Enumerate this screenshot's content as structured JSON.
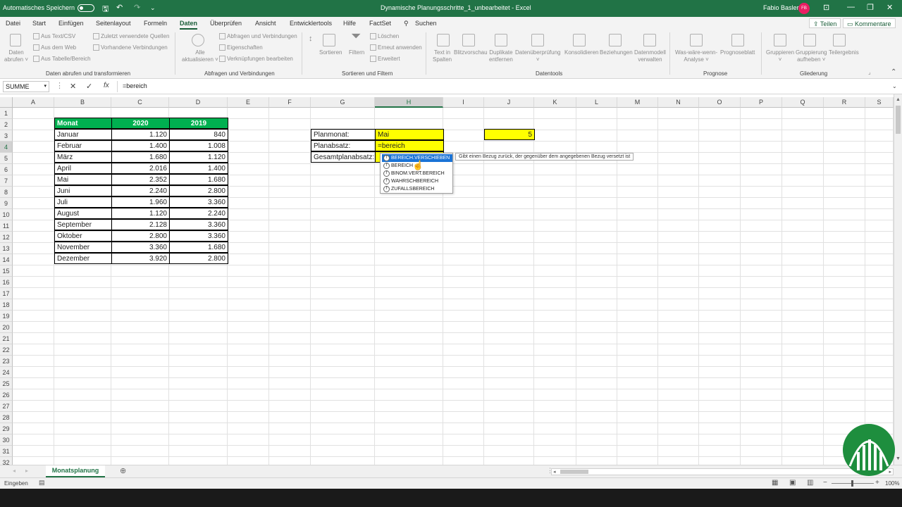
{
  "titlebar": {
    "autosave_label": "Automatisches Speichern",
    "doc_title": "Dynamische Planungsschritte_1_unbearbeitet  -  Excel",
    "user_name": "Fabio Basler",
    "user_initials": "FB"
  },
  "menu": {
    "items": [
      "Datei",
      "Start",
      "Einfügen",
      "Seitenlayout",
      "Formeln",
      "Daten",
      "Überprüfen",
      "Ansicht",
      "Entwicklertools",
      "Hilfe",
      "FactSet"
    ],
    "search_label": "Suchen",
    "share_label": "Teilen",
    "comments_label": "Kommentare"
  },
  "ribbon": {
    "daten_abrufen": "Daten\nabrufen ˅",
    "aus_text_csv": "Aus Text/CSV",
    "aus_dem_web": "Aus dem Web",
    "aus_tabelle": "Aus Tabelle/Bereich",
    "zuletzt": "Zuletzt verwendete Quellen",
    "vorhandene": "Vorhandene Verbindungen",
    "alle_aktualisieren": "Alle\naktualisieren ˅",
    "abfragen": "Abfragen und Verbindungen",
    "eigenschaften": "Eigenschaften",
    "verknuepfungen": "Verknüpfungen bearbeiten",
    "sortieren": "Sortieren",
    "filtern": "Filtern",
    "loeschen": "Löschen",
    "erneut": "Erneut anwenden",
    "erweitert": "Erweitert",
    "text_in_spalten": "Text in\nSpalten",
    "blitzvorschau": "Blitzvorschau",
    "duplikate": "Duplikate\nentfernen",
    "datenueberpruefung": "Datenüberprüfung\n˅",
    "konsolidieren": "Konsolidieren",
    "beziehungen": "Beziehungen",
    "datenmodell": "Datenmodell\nverwalten",
    "was_waere": "Was-wäre-wenn-\nAnalyse ˅",
    "prognoseblatt": "Prognoseblatt",
    "gruppieren": "Gruppieren\n˅",
    "gruppierung_aufheben": "Gruppierung\naufheben ˅",
    "teilergebnis": "Teilergebnis",
    "groups": {
      "daten_abrufen": "Daten abrufen und transformieren",
      "abfragen": "Abfragen und Verbindungen",
      "sortieren": "Sortieren und Filtern",
      "datentools": "Datentools",
      "prognose": "Prognose",
      "gliederung": "Gliederung"
    }
  },
  "formula_bar": {
    "name_box": "SUMME",
    "formula": "=bereich"
  },
  "columns": [
    "A",
    "B",
    "C",
    "D",
    "E",
    "F",
    "G",
    "H",
    "I",
    "J",
    "K",
    "L",
    "M",
    "N",
    "O",
    "P",
    "Q",
    "R",
    "S"
  ],
  "rows": [
    "1",
    "2",
    "3",
    "4",
    "5",
    "6",
    "7",
    "8",
    "9",
    "10",
    "11",
    "12",
    "13",
    "14",
    "15",
    "16",
    "17",
    "18",
    "19",
    "20",
    "21",
    "22",
    "23",
    "24",
    "25",
    "26",
    "27",
    "28",
    "29",
    "30",
    "31",
    "32"
  ],
  "table": {
    "headers": [
      "Monat",
      "2020",
      "2019"
    ],
    "rows": [
      [
        "Januar",
        "1.120",
        "840"
      ],
      [
        "Februar",
        "1.400",
        "1.008"
      ],
      [
        "März",
        "1.680",
        "1.120"
      ],
      [
        "April",
        "2.016",
        "1.400"
      ],
      [
        "Mai",
        "2.352",
        "1.680"
      ],
      [
        "Juni",
        "2.240",
        "2.800"
      ],
      [
        "Juli",
        "1.960",
        "3.360"
      ],
      [
        "August",
        "1.120",
        "2.240"
      ],
      [
        "September",
        "2.128",
        "3.360"
      ],
      [
        "Oktober",
        "2.800",
        "3.360"
      ],
      [
        "November",
        "3.360",
        "1.680"
      ],
      [
        "Dezember",
        "3.920",
        "2.800"
      ]
    ]
  },
  "planning": {
    "planmonat_label": "Planmonat:",
    "planmonat_value": "Mai",
    "planabsatz_label": "Planabsatz:",
    "planabsatz_value": "=bereich",
    "gesamt_label": "Gesamtplanabsatz:",
    "j3_value": "5"
  },
  "autocomplete": {
    "items": [
      "BEREICH.VERSCHIEBEN",
      "BEREICH",
      "BINOM.VERT.BEREICH",
      "WAHRSCHBEREICH",
      "ZUFALLSBEREICH"
    ],
    "tooltip": "Gibt einen Bezug zurück, der gegenüber dem angegebenen Bezug versetzt ist"
  },
  "sheet_tab": "Monatsplanung",
  "status": {
    "mode": "Eingeben",
    "zoom": "100%"
  },
  "colors": {
    "excel_green": "#217346",
    "header_green": "#00b050",
    "highlight_yellow": "#ffff00",
    "autocomplete_blue": "#1a73d6"
  }
}
